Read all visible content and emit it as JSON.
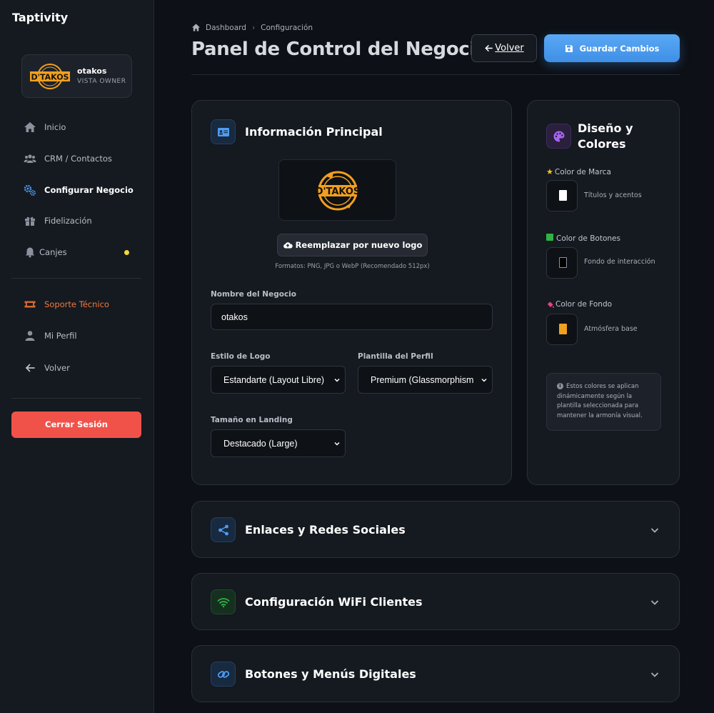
{
  "brand": "Taptivity",
  "profile": {
    "name": "otakos",
    "role": "VISTA OWNER",
    "logo_text": "D'TAKOS"
  },
  "sidebar": {
    "items": [
      {
        "label": "Inicio",
        "icon": "home-icon"
      },
      {
        "label": "CRM / Contactos",
        "icon": "users-icon"
      },
      {
        "label": "Configurar Negocio",
        "icon": "gears-icon",
        "active": true
      },
      {
        "label": "Fidelización",
        "icon": "gift-icon"
      },
      {
        "label": "Canjes",
        "icon": "bell-icon",
        "badge_color": "#f3d83a"
      }
    ],
    "secondary": [
      {
        "label": "Soporte Técnico",
        "icon": "ticket-icon",
        "color": "#f07a3a"
      },
      {
        "label": "Mi Perfil",
        "icon": "user-icon"
      },
      {
        "label": "Volver",
        "icon": "arrow-left-icon"
      }
    ],
    "logout_label": "Cerrar Sesión"
  },
  "header": {
    "breadcrumb": [
      "Dashboard",
      "Configuración"
    ],
    "title": "Panel de Control del Negocio",
    "back_label": "Volver",
    "save_label": "Guardar Cambios"
  },
  "main_info": {
    "title": "Información Principal",
    "logo_text": "D'TAKOS",
    "replace_logo_label": "Reemplazar por nuevo logo",
    "formats_hint": "Formatos: PNG, JPG o WebP (Recomendado 512px)",
    "business_name_label": "Nombre del Negocio",
    "business_name_value": "otakos",
    "logo_style_label": "Estilo de Logo",
    "logo_style_value": "Estandarte (Layout Libre)",
    "profile_template_label": "Plantilla del Perfil",
    "profile_template_value": "Premium (Glassmorphism",
    "landing_size_label": "Tamaño en Landing",
    "landing_size_value": "Destacado (Large)"
  },
  "design": {
    "title_line1": "Diseño y",
    "title_line2": "Colores",
    "brand_color": {
      "label": "Color de Marca",
      "desc": "Títulos y acentos",
      "value": "#ffffff"
    },
    "button_color": {
      "label": "Color de Botones",
      "desc": "Fondo de interacción",
      "value": "#000000"
    },
    "background_color": {
      "label": "Color de Fondo",
      "desc": "Atmósfera base",
      "value": "#f0a020"
    },
    "note": "Estos colores se aplican dinámicamente según la plantilla seleccionada para mantener la armonía visual."
  },
  "accordions": [
    {
      "title": "Enlaces y Redes Sociales",
      "icon": "share-icon"
    },
    {
      "title": "Configuración WiFi Clientes",
      "icon": "wifi-icon"
    },
    {
      "title": "Botones y Menús Digitales",
      "icon": "link-icon"
    }
  ],
  "colors": {
    "accent": "#3e8fe6",
    "danger": "#f0524a",
    "support": "#f07a3a",
    "logo_gold": "#f0a020"
  }
}
